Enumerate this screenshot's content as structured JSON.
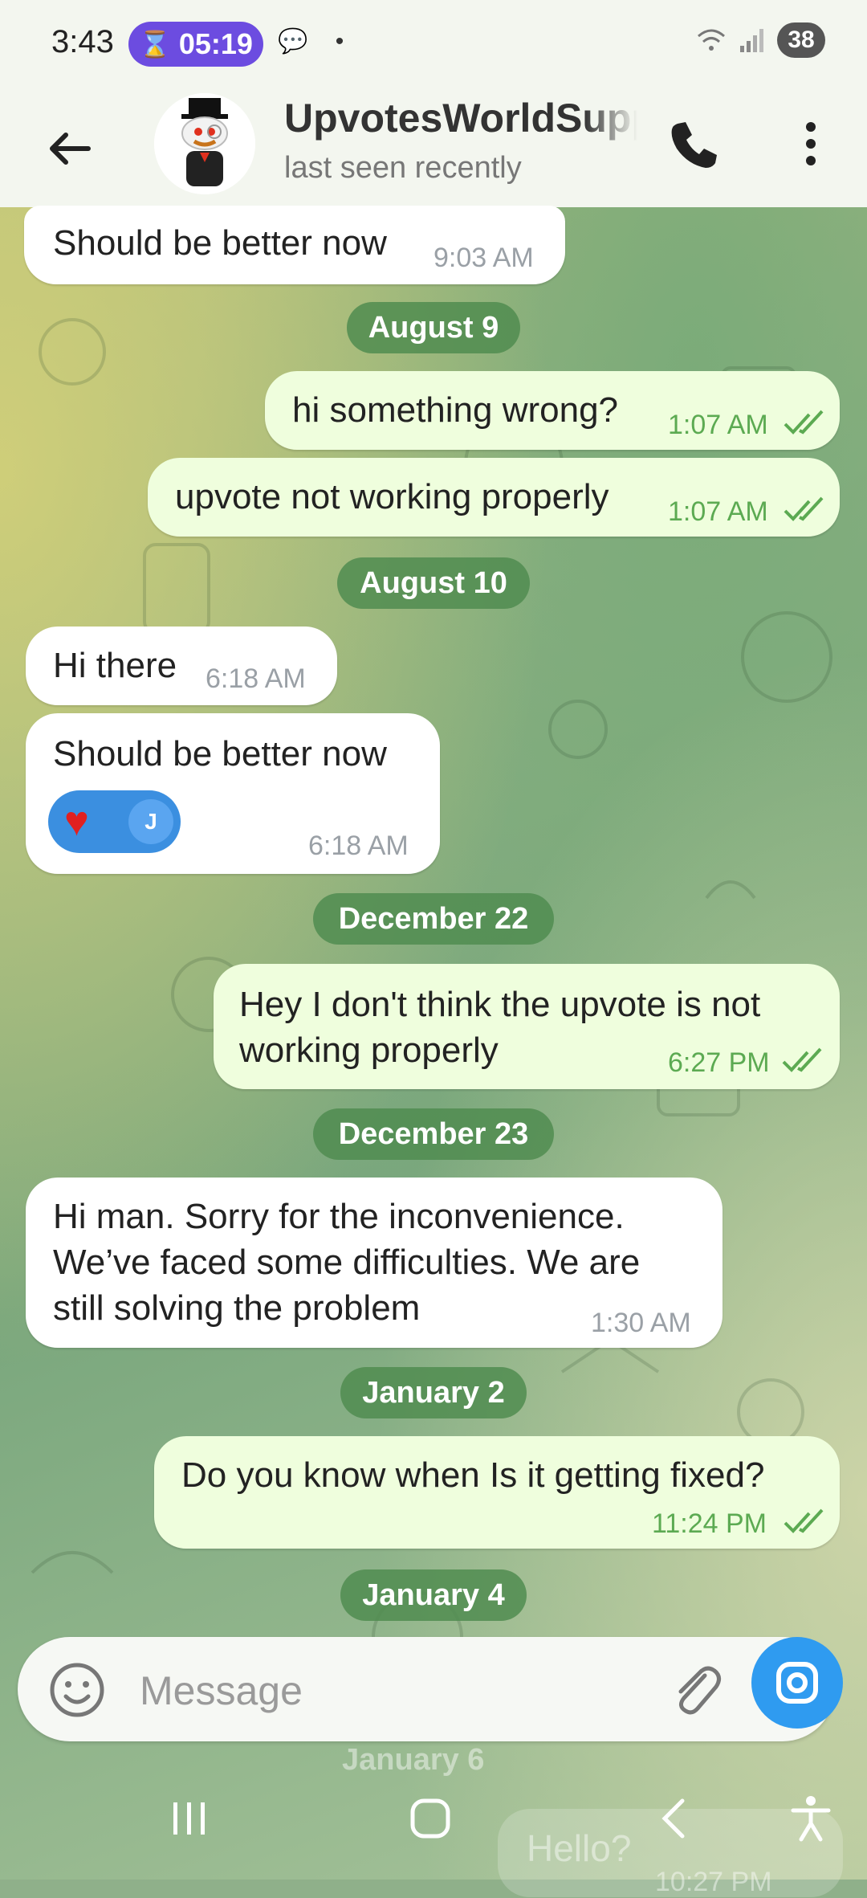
{
  "status_bar": {
    "time": "3:43",
    "timer": "05:19",
    "wifi_label": "5",
    "battery": "38"
  },
  "header": {
    "title": "UpvotesWorldSupport",
    "subtitle": "last seen recently"
  },
  "messages": [
    {
      "type": "in",
      "text": "Should be better now",
      "time": "9:03 AM"
    },
    {
      "type": "date",
      "text": "August 9"
    },
    {
      "type": "out",
      "text": "hi something wrong?",
      "time": "1:07 AM"
    },
    {
      "type": "out",
      "text": "upvote not working properly",
      "time": "1:07 AM"
    },
    {
      "type": "date",
      "text": "August 10"
    },
    {
      "type": "in",
      "text": "Hi there",
      "time": "6:18 AM"
    },
    {
      "type": "in",
      "text": "Should be better now",
      "time": "6:18 AM",
      "reaction": {
        "emoji": "♥",
        "user_initial": "J"
      }
    },
    {
      "type": "date",
      "text": "December 22"
    },
    {
      "type": "out",
      "text_lines": [
        "Hey I don't think the upvote is not",
        "working properly"
      ],
      "time": "6:27 PM"
    },
    {
      "type": "date",
      "text": "December 23"
    },
    {
      "type": "in",
      "text_lines": [
        "Hi man. Sorry for the inconvenience.",
        "We’ve faced some difficulties. We are",
        "still solving the problem"
      ],
      "time": "1:30 AM"
    },
    {
      "type": "date",
      "text": "January 2"
    },
    {
      "type": "out",
      "text": "Do you know when Is it getting fixed?",
      "time": "11:24 PM"
    },
    {
      "type": "date",
      "text": "January 4"
    }
  ],
  "behind_input": {
    "date": "January 6",
    "text": "Hello?",
    "time": "10:27 PM"
  },
  "input": {
    "placeholder": "Message"
  },
  "colors": {
    "accent": "#2f9bf0",
    "outgoing_bubble": "#effedd",
    "incoming_bubble": "#ffffff",
    "date_chip": "#5a9a58",
    "timer_pill": "#6c4ce0"
  },
  "icons": [
    "back-arrow-icon",
    "phone-icon",
    "more-vert-icon",
    "emoji-icon",
    "attach-icon",
    "camera-icon",
    "double-check-icon",
    "heart-icon"
  ]
}
